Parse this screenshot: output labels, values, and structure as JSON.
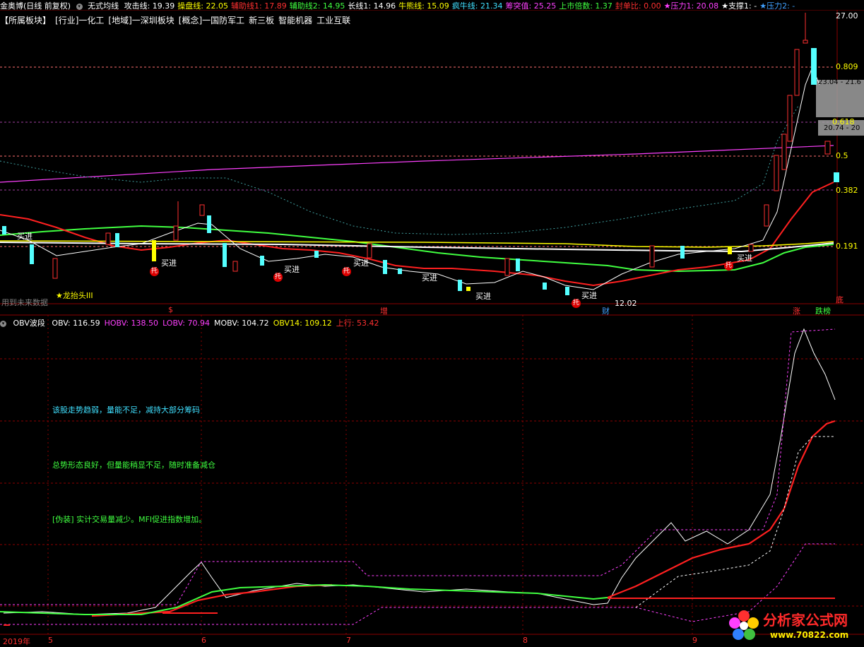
{
  "top_bar": {
    "app": "金奥博(日线 前复权)",
    "indicator": "无式均线",
    "items": [
      {
        "label": "攻击线: 19.39",
        "color": "#ffffff"
      },
      {
        "label": "操盘线: 22.05",
        "color": "#ffff00"
      },
      {
        "label": "辅助线1: 17.89",
        "color": "#ff3030"
      },
      {
        "label": "辅助线2: 14.95",
        "color": "#40ff40"
      },
      {
        "label": "长线1: 14.96",
        "color": "#ffffff"
      },
      {
        "label": "牛熊线: 15.09",
        "color": "#ffff00"
      },
      {
        "label": "疯牛线: 21.34",
        "color": "#40e0ff"
      },
      {
        "label": "筹突值: 25.25",
        "color": "#ff40ff"
      },
      {
        "label": "上市倍数: 1.37",
        "color": "#40ff40"
      },
      {
        "label": "封单比: 0.00",
        "color": "#ff3030"
      },
      {
        "label": "★压力1: 20.08",
        "color": "#ff40ff"
      },
      {
        "label": "★支撑1: -",
        "color": "#ffffff"
      },
      {
        "label": "★压力2: -",
        "color": "#40a0ff"
      }
    ]
  },
  "sector_bar": {
    "items": [
      "【所属板块】",
      "[行业]一化工",
      "[地域]一深圳板块",
      "[概念]一国防军工",
      "新三板",
      "智能机器",
      "工业互联"
    ]
  },
  "price_panel": {
    "price_labels": [
      {
        "text": "27.00",
        "color": "#ffffff"
      },
      {
        "text": "0.809",
        "color": "#ffff00"
      },
      {
        "text": "23.04 - 21.6",
        "color": "#ffffff"
      },
      {
        "text": "0.618",
        "color": "#ffff00"
      },
      {
        "text": "20.74 - 20",
        "color": "#ffffff"
      },
      {
        "text": "0.5",
        "color": "#ffff00"
      },
      {
        "text": "0.382",
        "color": "#ffff00"
      },
      {
        "text": "0.191",
        "color": "#ffff00"
      },
      {
        "text": "12.02",
        "color": "#ffffff"
      }
    ],
    "buy_signal": "买进",
    "tuo_signal": "托",
    "dragon_label": "★龙抬头III",
    "future_data_label": "用到未来数据",
    "bottom_markers": [
      {
        "text": "$",
        "color": "#ff3030"
      },
      {
        "text": "增",
        "color": "#ff3030"
      },
      {
        "text": "财",
        "color": "#40a0ff"
      },
      {
        "text": "涨",
        "color": "#ff3030"
      },
      {
        "text": "跌榜",
        "color": "#40ff40"
      },
      {
        "text": "底",
        "color": "#ff3030"
      }
    ]
  },
  "obv_bar": {
    "name": "OBV波段",
    "items": [
      {
        "label": "OBV: 116.59",
        "color": "#ffffff"
      },
      {
        "label": "HOBV: 138.50",
        "color": "#ff40ff"
      },
      {
        "label": "LOBV: 70.94",
        "color": "#ff40ff"
      },
      {
        "label": "MOBV: 104.72",
        "color": "#ffffff"
      },
      {
        "label": "OBV14: 109.12",
        "color": "#ffff00"
      },
      {
        "label": "上行: 53.42",
        "color": "#ff3030"
      }
    ]
  },
  "messages": [
    {
      "text": "该股走势趋弱，量能不足，减持大部分筹码",
      "color": "#40e0ff"
    },
    {
      "text": "总势形态良好，但量能稍显不足，随时准备减仓",
      "color": "#40ff40"
    },
    {
      "text": "[伪装] 实计交易量减少。MFI促进指数增加。",
      "color": "#40ff40"
    }
  ],
  "x_axis": {
    "labels": [
      "2019年",
      "5",
      "6",
      "7",
      "8",
      "9"
    ]
  },
  "watermark": {
    "title": "分析家公式网",
    "url": "www.70822.com"
  },
  "colors": {
    "up_candle": "#ff3030",
    "down_candle": "#54ffff",
    "grid": "#8b0000",
    "boll": "#ff40ff"
  }
}
